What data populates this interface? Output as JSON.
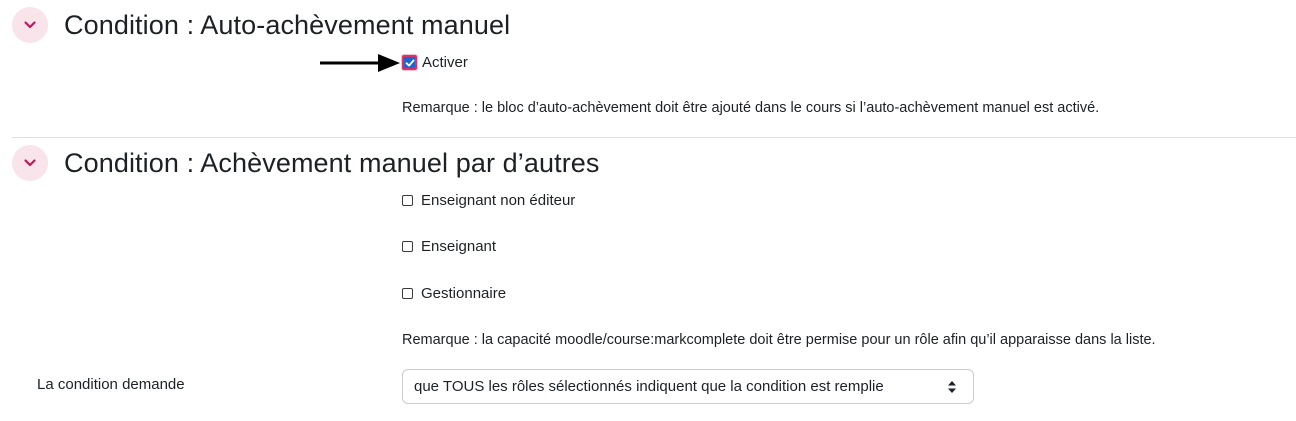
{
  "section1": {
    "title": "Condition : Auto-achèvement manuel",
    "enable_label": "Activer",
    "enable_checked": true,
    "note": "Remarque : le bloc d’auto-achèvement doit être ajouté dans le cours si l’auto-achèvement manuel est activé."
  },
  "section2": {
    "title": "Condition : Achèvement manuel par d’autres",
    "roles": [
      {
        "label": "Enseignant non éditeur",
        "checked": false
      },
      {
        "label": "Enseignant",
        "checked": false
      },
      {
        "label": "Gestionnaire",
        "checked": false
      }
    ],
    "note": "Remarque : la capacité moodle/course:markcomplete doit être permise pour un rôle afin qu’il apparaisse dans la liste.",
    "requirement_label": "La condition demande",
    "requirement_value": "que TOUS les rôles sélectionnés indiquent que la condition est remplie"
  },
  "icons": {
    "collapse": "chevron-down-icon",
    "select_caret": "sort-caret-icon",
    "pointer": "arrow-right-icon"
  },
  "colors": {
    "accent": "#d6336c",
    "checkbox_fill": "#1967d2",
    "collapse_bg": "#f8e4ea"
  }
}
